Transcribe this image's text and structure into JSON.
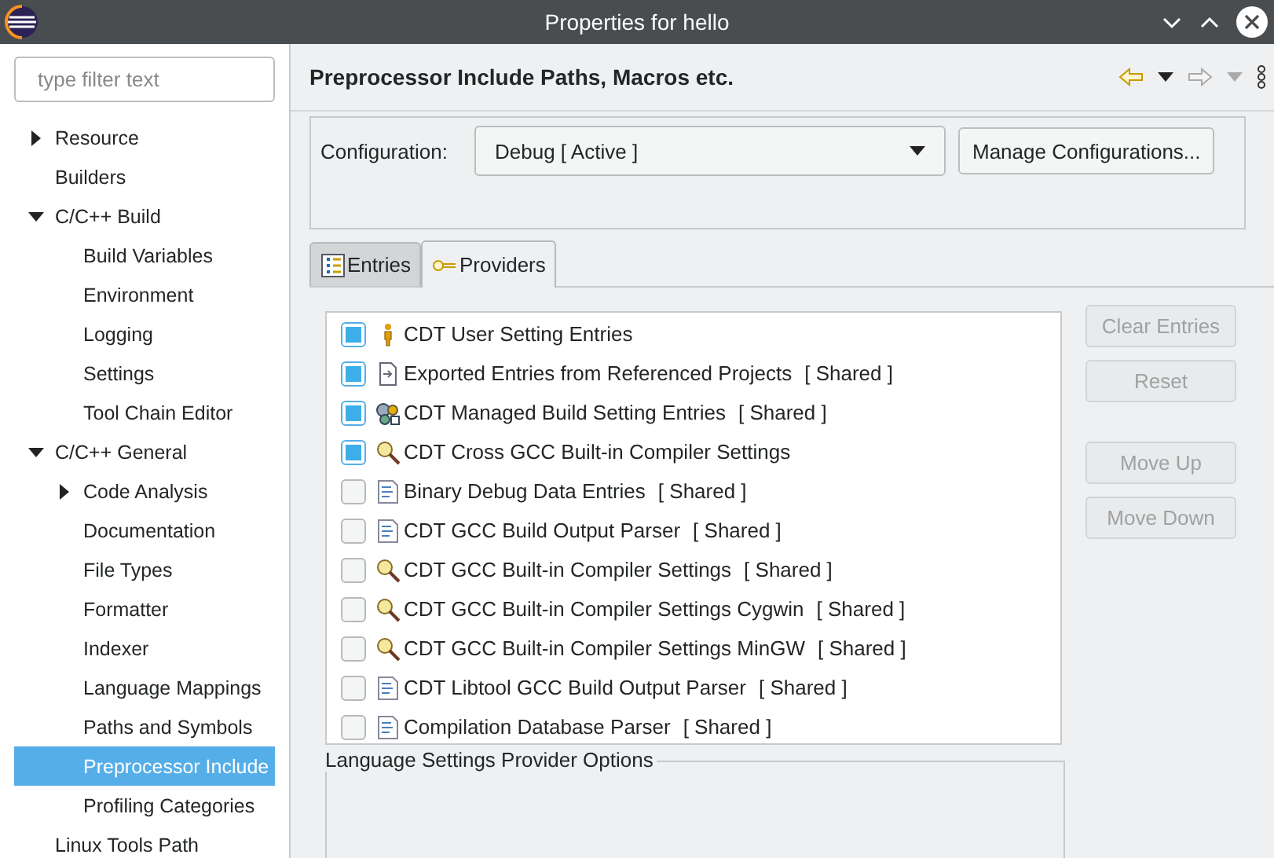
{
  "window": {
    "title": "Properties for hello"
  },
  "sidebar": {
    "filter": {
      "placeholder": "type filter text"
    },
    "items": [
      {
        "label": "Resource",
        "expanded": false,
        "selected": false
      },
      {
        "label": "Builders",
        "selected": false
      },
      {
        "label": "C/C++ Build",
        "expanded": true,
        "selected": false,
        "children": [
          {
            "label": "Build Variables",
            "selected": false
          },
          {
            "label": "Environment",
            "selected": false
          },
          {
            "label": "Logging",
            "selected": false
          },
          {
            "label": "Settings",
            "selected": false
          },
          {
            "label": "Tool Chain Editor",
            "selected": false
          }
        ]
      },
      {
        "label": "C/C++ General",
        "expanded": true,
        "selected": false,
        "children": [
          {
            "label": "Code Analysis",
            "expanded": false,
            "selected": false
          },
          {
            "label": "Documentation",
            "selected": false
          },
          {
            "label": "File Types",
            "selected": false
          },
          {
            "label": "Formatter",
            "selected": false
          },
          {
            "label": "Indexer",
            "selected": false
          },
          {
            "label": "Language Mappings",
            "selected": false
          },
          {
            "label": "Paths and Symbols",
            "selected": false
          },
          {
            "label": "Preprocessor Include",
            "selected": true
          },
          {
            "label": "Profiling Categories",
            "selected": false
          }
        ]
      },
      {
        "label": "Linux Tools Path",
        "selected": false
      }
    ]
  },
  "page": {
    "title": "Preprocessor Include Paths, Macros etc.",
    "configuration": {
      "label": "Configuration:",
      "value": "Debug  [ Active ]",
      "button": "Manage Configurations..."
    },
    "tabs": [
      {
        "label": "Entries",
        "kind": "entries",
        "selected": false
      },
      {
        "label": "Providers",
        "kind": "providers",
        "selected": true
      }
    ],
    "providers": [
      {
        "name": "CDT User Setting Entries",
        "kind": "user",
        "checked": true
      },
      {
        "name": "Exported Entries from Referenced Projects",
        "shared": "[ Shared ]",
        "kind": "import",
        "checked": true
      },
      {
        "name": "CDT Managed Build Setting Entries",
        "shared": "[ Shared ]",
        "kind": "gears",
        "checked": true
      },
      {
        "name": "CDT Cross GCC Built-in Compiler Settings",
        "kind": "detector",
        "checked": true
      },
      {
        "name": "Binary Debug Data Entries",
        "shared": "[ Shared ]",
        "kind": "parser",
        "checked": false
      },
      {
        "name": "CDT GCC Build Output Parser",
        "shared": "[ Shared ]",
        "kind": "parser",
        "checked": false
      },
      {
        "name": "CDT GCC Built-in Compiler Settings",
        "shared": "[ Shared ]",
        "kind": "detector",
        "checked": false
      },
      {
        "name": "CDT GCC Built-in Compiler Settings Cygwin",
        "shared": "[ Shared ]",
        "kind": "detector",
        "checked": false
      },
      {
        "name": "CDT GCC Built-in Compiler Settings MinGW",
        "shared": "[ Shared ]",
        "kind": "detector",
        "checked": false
      },
      {
        "name": "CDT Libtool GCC Build Output Parser",
        "shared": "[ Shared ]",
        "kind": "parser",
        "checked": false
      },
      {
        "name": "Compilation Database Parser",
        "shared": "[ Shared ]",
        "kind": "parser",
        "checked": false
      }
    ],
    "button_groups": [
      [
        {
          "label": "Clear Entries",
          "disabled": true
        },
        {
          "label": "Reset",
          "disabled": true
        }
      ],
      [
        {
          "label": "Move Up",
          "disabled": true
        },
        {
          "label": "Move Down",
          "disabled": true
        }
      ]
    ],
    "options_group": {
      "title": "Language Settings Provider Options"
    }
  }
}
